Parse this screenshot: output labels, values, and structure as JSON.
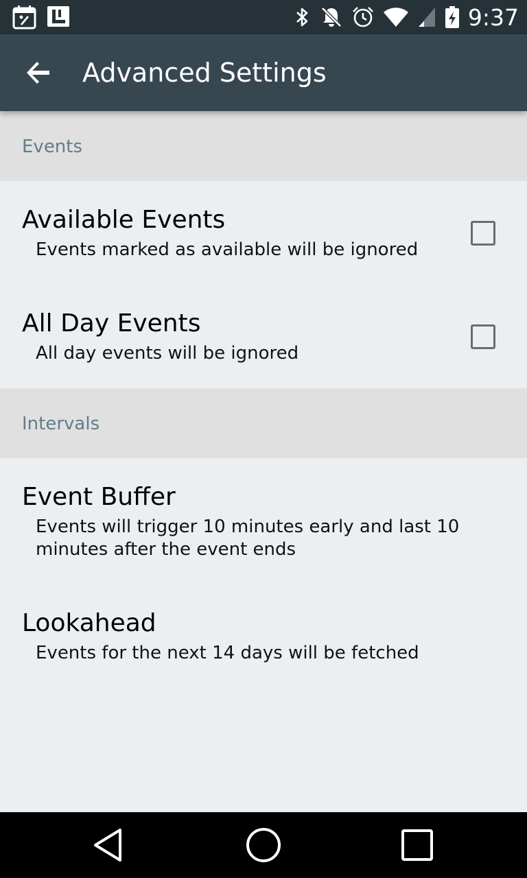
{
  "status_bar": {
    "time": "9:37",
    "left_icons": [
      "calendar-app-icon",
      "app-l-icon"
    ],
    "right_icons": [
      "bluetooth-icon",
      "notifications-off-icon",
      "alarm-icon",
      "wifi-icon",
      "signal-icon",
      "battery-charging-icon"
    ]
  },
  "app_bar": {
    "title": "Advanced Settings",
    "back_icon": "arrow-back-icon"
  },
  "sections": [
    {
      "header": "Events",
      "items": [
        {
          "title": "Available Events",
          "summary": "Events marked as available will be ignored",
          "checked": false
        },
        {
          "title": "All Day Events",
          "summary": "All day events will be ignored",
          "checked": false
        }
      ]
    },
    {
      "header": "Intervals",
      "items": [
        {
          "title": "Event Buffer",
          "summary": "Events will trigger 10 minutes early and last 10 minutes after the event ends"
        },
        {
          "title": "Lookahead",
          "summary": "Events for the next 14 days will be fetched"
        }
      ]
    }
  ],
  "nav_bar": {
    "icons": [
      "back-triangle-icon",
      "home-circle-icon",
      "recents-square-icon"
    ]
  },
  "colors": {
    "status_bar": "#263238",
    "app_bar": "#37474f",
    "section_header_bg": "#e0e0e0",
    "section_header_text": "#607d8b",
    "content_bg": "#eceff1"
  }
}
